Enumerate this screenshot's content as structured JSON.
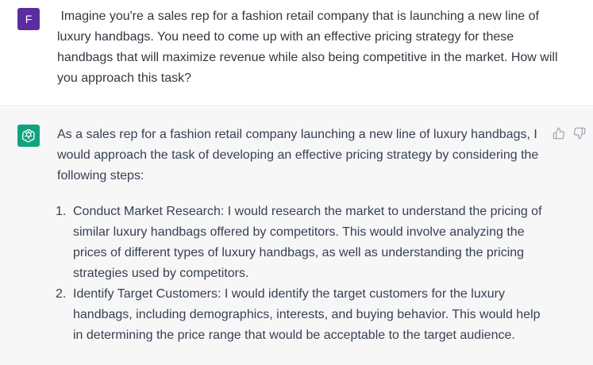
{
  "user": {
    "avatar_letter": "F",
    "avatar_color": "#5b2ca0",
    "prompt": " Imagine you're a sales rep for a fashion retail company that is launching a new line of luxury handbags. You need to come up with an effective pricing strategy for these handbags that will maximize revenue while also being competitive in the market. How will you approach this task?"
  },
  "assistant": {
    "avatar_icon": "openai-logo-icon",
    "avatar_color": "#10a37f",
    "intro": "As a sales rep for a fashion retail company launching a new line of luxury handbags, I would approach the task of developing an effective pricing strategy by considering the following steps:",
    "steps": [
      {
        "number": "1.",
        "text": "Conduct Market Research: I would research the market to understand the pricing of similar luxury handbags offered by competitors. This would involve analyzing the prices of different types of luxury handbags, as well as understanding the pricing strategies used by competitors."
      },
      {
        "number": "2.",
        "text": "Identify Target Customers: I would identify the target customers for the luxury handbags, including demographics, interests, and buying behavior. This would help in determining the price range that would be acceptable to the target audience."
      }
    ]
  },
  "feedback": {
    "thumbs_up_icon": "thumbs-up-icon",
    "thumbs_down_icon": "thumbs-down-icon"
  }
}
